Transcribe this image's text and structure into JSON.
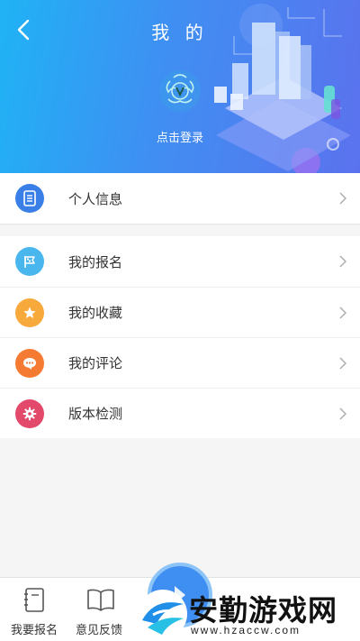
{
  "header": {
    "title": "我 的",
    "login_label": "点击登录"
  },
  "menu": {
    "personal_info": "个人信息",
    "items": [
      {
        "label": "我的报名",
        "icon": "flag-icon",
        "color": "#4ab6ee"
      },
      {
        "label": "我的收藏",
        "icon": "star-icon",
        "color": "#f7a93c"
      },
      {
        "label": "我的评论",
        "icon": "chat-icon",
        "color": "#f57b32"
      },
      {
        "label": "版本检测",
        "icon": "gear-icon",
        "color": "#e2496a"
      }
    ]
  },
  "bottom_nav": {
    "tabs": [
      {
        "label": "我要报名",
        "icon": "notebook-icon"
      },
      {
        "label": "意见反馈",
        "icon": "book-icon"
      }
    ]
  },
  "watermark": {
    "text": "安勤游戏网",
    "url": "www.hzaccw.com"
  },
  "colors": {
    "header_start": "#1fb3f5",
    "header_end": "#5b72ee",
    "personal_icon": "#3a7fe8"
  }
}
